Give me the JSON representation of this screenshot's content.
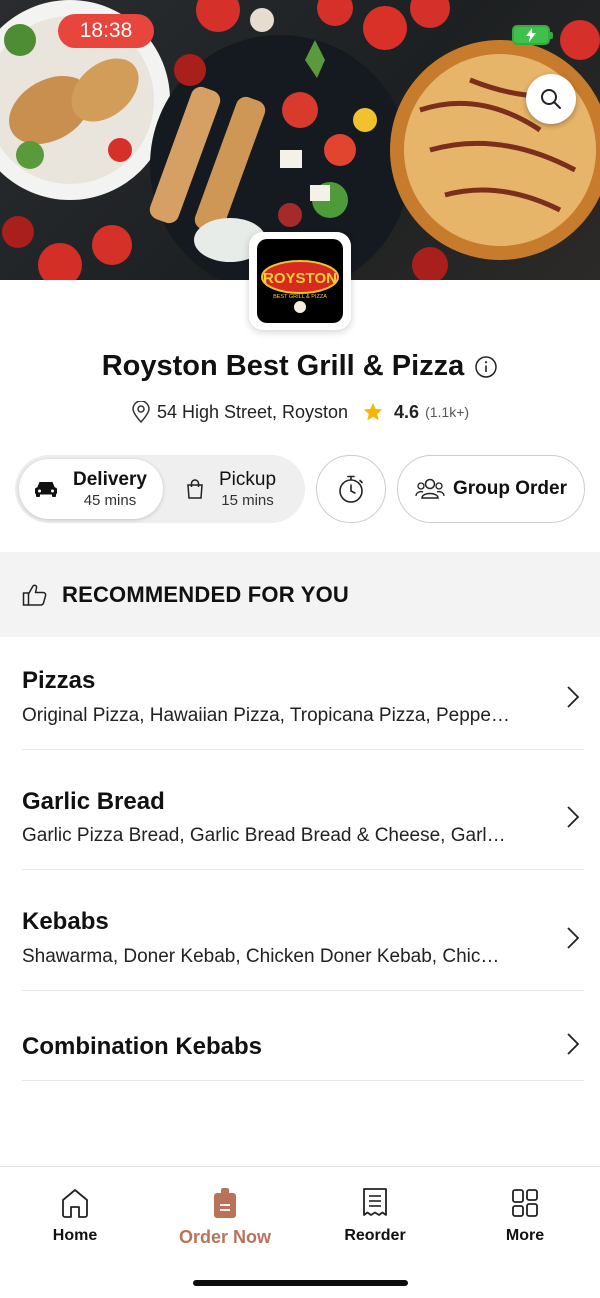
{
  "status_bar": {
    "time": "18:38"
  },
  "restaurant": {
    "name": "Royston Best Grill & Pizza",
    "logo_text": "ROYSTON",
    "logo_subtext": "BEST GRILL & PIZZA",
    "address": "54 High Street, Royston",
    "rating": "4.6",
    "rating_count": "(1.1k+)"
  },
  "order_modes": {
    "delivery": {
      "label": "Delivery",
      "time": "45 mins"
    },
    "pickup": {
      "label": "Pickup",
      "time": "15 mins"
    },
    "selected": "Delivery"
  },
  "group_order_label": "Group Order",
  "recommended_label": "RECOMMENDED FOR YOU",
  "categories": [
    {
      "name": "Pizzas",
      "items": "Original Pizza, Hawaiian Pizza, Tropicana Pizza, Peppe…"
    },
    {
      "name": "Garlic Bread",
      "items": "Garlic Pizza Bread, Garlic Bread Bread & Cheese, Garl…"
    },
    {
      "name": "Kebabs",
      "items": "Shawarma, Doner Kebab, Chicken Doner Kebab, Chic…"
    },
    {
      "name": "Combination Kebabs",
      "items": ""
    }
  ],
  "bottom_nav": {
    "items": [
      {
        "label": "Home",
        "icon": "home-icon"
      },
      {
        "label": "Order Now",
        "icon": "order-bag-icon"
      },
      {
        "label": "Reorder",
        "icon": "receipt-icon"
      },
      {
        "label": "More",
        "icon": "grid-icon"
      }
    ],
    "active": "Order Now"
  },
  "colors": {
    "accent": "#b9735a",
    "status_pill": "#e8453c",
    "star": "#f5b800",
    "battery": "#3ec04a"
  }
}
